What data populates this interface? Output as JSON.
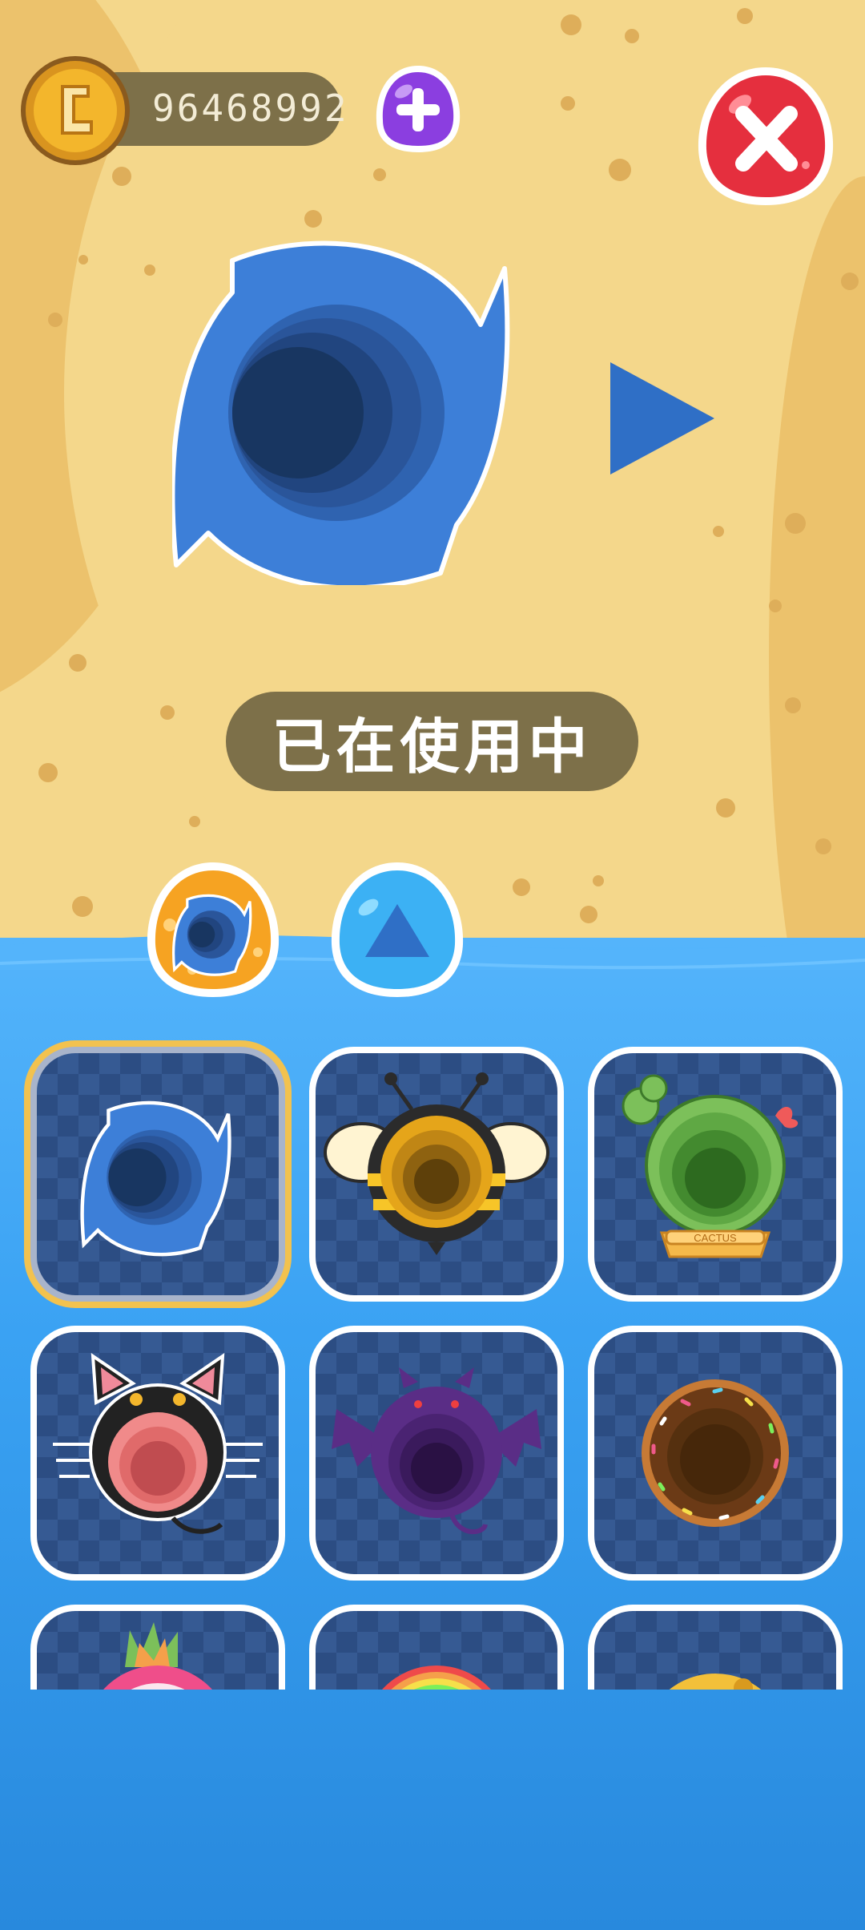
{
  "wallet": {
    "coin_amount": "96468992"
  },
  "preview": {
    "status_label": "已在使用中"
  },
  "tabs": [
    {
      "id": "skins",
      "selected": true
    },
    {
      "id": "shapes",
      "selected": false
    }
  ],
  "grid": {
    "items": [
      {
        "name": "swirl-hole",
        "selected": true
      },
      {
        "name": "bee-hole",
        "selected": false
      },
      {
        "name": "cactus-hole",
        "selected": false,
        "label": "CACTUS"
      },
      {
        "name": "cat-hole",
        "selected": false
      },
      {
        "name": "bat-hole",
        "selected": false
      },
      {
        "name": "donut-hole",
        "selected": false
      },
      {
        "name": "dragonfruit-hole",
        "selected": false
      },
      {
        "name": "rainbow-hole",
        "selected": false
      },
      {
        "name": "cheese-hole",
        "selected": false
      }
    ]
  },
  "colors": {
    "sand": "#f4d78b",
    "water": "#3aa2f3",
    "pill": "#7d7049",
    "skin_blue": "#3d7fd8",
    "close_red": "#e52f3e",
    "plus_purple": "#8b3ee0"
  }
}
